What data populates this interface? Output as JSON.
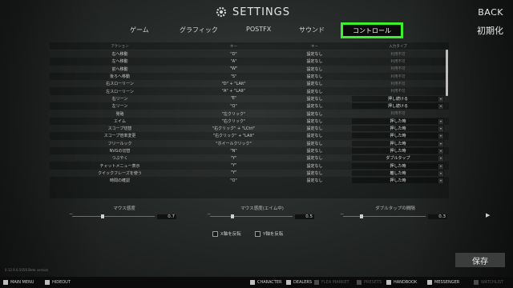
{
  "header": {
    "title": "SETTINGS",
    "back": "BACK",
    "reset": "初期化"
  },
  "tabs": [
    {
      "label": "ゲーム"
    },
    {
      "label": "グラフィック"
    },
    {
      "label": "POSTFX"
    },
    {
      "label": "サウンド"
    },
    {
      "label": "コントロール",
      "active": true
    }
  ],
  "table": {
    "headers": [
      "アクション",
      "キー",
      "キー",
      "入力タイプ"
    ],
    "rows": [
      [
        "右へ移動",
        "\"D\"",
        "設定なし",
        "利用不可"
      ],
      [
        "左へ移動",
        "\"A\"",
        "設定なし",
        "利用不可"
      ],
      [
        "前へ移動",
        "\"W\"",
        "設定なし",
        "利用不可"
      ],
      [
        "後ろへ移動",
        "\"S\"",
        "設定なし",
        "利用不可"
      ],
      [
        "右スローリーン",
        "\"D\" + \"LAlt\"",
        "設定なし",
        "利用不可"
      ],
      [
        "左スローリーン",
        "\"A\" + \"LAlt\"",
        "設定なし",
        "利用不可"
      ],
      [
        "右リーン",
        "\"E\"",
        "設定なし",
        "押し続ける"
      ],
      [
        "左リーン",
        "\"Q\"",
        "設定なし",
        "押し続ける"
      ],
      [
        "発砲",
        "\"左クリック\"",
        "設定なし",
        "利用不可"
      ],
      [
        "エイム",
        "\"右クリック\"",
        "設定なし",
        "押した時"
      ],
      [
        "スコープ切替",
        "\"右クリック\" + \"LCtrl\"",
        "設定なし",
        "押した時"
      ],
      [
        "スコープ倍率変更",
        "\"右クリック\" + \"LAlt\"",
        "設定なし",
        "押した時"
      ],
      [
        "フリールック",
        "\"ホイールクリック\"",
        "設定なし",
        "押した時"
      ],
      [
        "NVGの切替",
        "\"N\"",
        "設定なし",
        "押した時"
      ],
      [
        "つぶやく",
        "\"Y\"",
        "設定なし",
        "ダブルタップ"
      ],
      [
        "チャットメニュー表示",
        "\"Y\"",
        "設定なし",
        "押した時"
      ],
      [
        "クイックフレーズを使う",
        "\"Y\"",
        "設定なし",
        "離した時"
      ],
      [
        "時間の確認",
        "\"O\"",
        "設定なし",
        "押した時"
      ]
    ]
  },
  "sliders": [
    {
      "label": "マウス感度",
      "value": "0.7",
      "fraction": 0.35
    },
    {
      "label": "マウス感度(エイム中)",
      "value": "0.5",
      "fraction": 0.25
    },
    {
      "label": "ダブルタップの間隔",
      "value": "0.3",
      "fraction": 0.2
    }
  ],
  "checkboxes": [
    {
      "label": "X軸を反転",
      "checked": false
    },
    {
      "label": "Y軸を反転",
      "checked": false
    }
  ],
  "version": "0.12.9.0.5056 Beta version",
  "save": "保存",
  "bottombar": [
    {
      "label": "MAIN MENU",
      "icon": "menu-icon",
      "enabled": true
    },
    {
      "label": "HIDEOUT",
      "icon": "hideout-icon",
      "enabled": true
    },
    {
      "label": "CHARACTER",
      "icon": "character-icon",
      "enabled": true
    },
    {
      "label": "DEALERS",
      "icon": "dealers-icon",
      "enabled": true
    },
    {
      "label": "FLEA MARKET",
      "icon": "flea-market-icon",
      "enabled": false
    },
    {
      "label": "PRESETS",
      "icon": "presets-icon",
      "enabled": false
    },
    {
      "label": "HANDBOOK",
      "icon": "handbook-icon",
      "enabled": true
    },
    {
      "label": "MESSENGER",
      "icon": "messenger-icon",
      "enabled": true
    },
    {
      "label": "WATCHLIST",
      "icon": "watchlist-icon",
      "enabled": false
    }
  ],
  "colors": {
    "active_tab_outline": "#3cf02a",
    "background": "#262a28"
  }
}
